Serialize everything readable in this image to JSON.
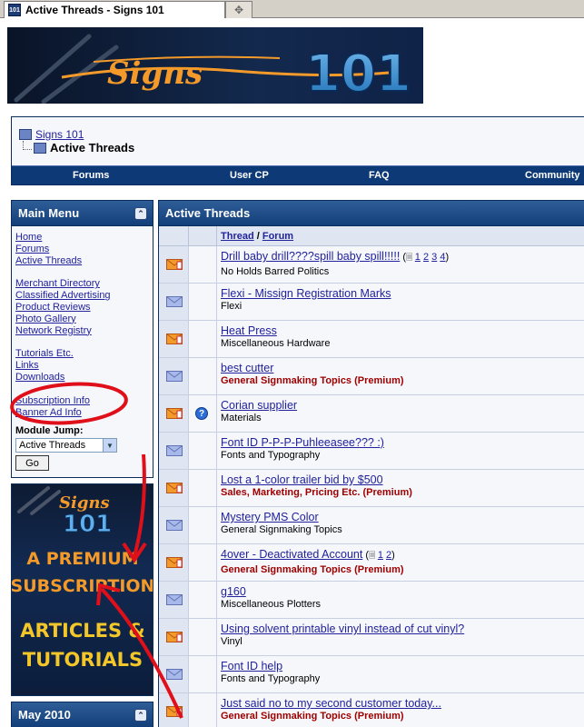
{
  "browser": {
    "tab_title": "Active Threads - Signs 101",
    "favicon": "101"
  },
  "banner": {
    "logo_script": "Signs",
    "logo_number": "101"
  },
  "breadcrumb": {
    "root": "Signs 101",
    "current": "Active Threads"
  },
  "navbar": [
    "Forums",
    "User CP",
    "FAQ",
    "Community"
  ],
  "main_menu": {
    "title": "Main Menu",
    "groups": [
      [
        "Home",
        "Forums",
        "Active Threads"
      ],
      [
        "Merchant Directory",
        "Classified Advertising",
        "Product Reviews",
        "Photo Gallery",
        "Network Registry"
      ],
      [
        "Tutorials Etc.",
        "Links",
        "Downloads"
      ],
      [
        "Subscription Info",
        "Banner Ad Info"
      ]
    ],
    "module_jump_label": "Module Jump:",
    "module_jump_value": "Active Threads",
    "go_label": "Go"
  },
  "ad": {
    "brand_script": "Signs",
    "brand_number": "101",
    "line1": "A PREMIUM",
    "line2": "SUBSCRIPTION",
    "line3": "ARTICLES &",
    "line4": "TUTORIALS"
  },
  "calendar": {
    "title": "May 2010"
  },
  "threads": {
    "title": "Active Threads",
    "col_thread": "Thread",
    "col_sep": " / ",
    "col_forum": "Forum",
    "rows": [
      {
        "title": "Drill baby drill????spill baby spill!!!!!",
        "forum": "No Holds Barred Politics",
        "premium": false,
        "hot": true,
        "pages": [
          "1",
          "2",
          "3",
          "4"
        ],
        "icon": ""
      },
      {
        "title": "Flexi - Missign Registration Marks",
        "forum": "Flexi",
        "premium": false,
        "hot": false,
        "pages": [],
        "icon": ""
      },
      {
        "title": "Heat Press",
        "forum": "Miscellaneous Hardware",
        "premium": false,
        "hot": true,
        "pages": [],
        "icon": ""
      },
      {
        "title": "best cutter",
        "forum": "General Signmaking Topics (Premium)",
        "premium": true,
        "hot": false,
        "pages": [],
        "icon": ""
      },
      {
        "title": "Corian supplier",
        "forum": "Materials",
        "premium": false,
        "hot": true,
        "pages": [],
        "icon": "question"
      },
      {
        "title": "Font ID P-P-P-Puhleeasee??? :)",
        "forum": "Fonts and Typography",
        "premium": false,
        "hot": false,
        "pages": [],
        "icon": ""
      },
      {
        "title": "Lost a 1-color trailer bid by $500",
        "forum": "Sales, Marketing, Pricing Etc. (Premium)",
        "premium": true,
        "hot": true,
        "pages": [],
        "icon": ""
      },
      {
        "title": "Mystery PMS Color",
        "forum": "General Signmaking Topics",
        "premium": false,
        "hot": false,
        "pages": [],
        "icon": ""
      },
      {
        "title": "4over - Deactivated Account",
        "forum": "General Signmaking Topics (Premium)",
        "premium": true,
        "hot": true,
        "pages": [
          "1",
          "2"
        ],
        "icon": ""
      },
      {
        "title": "g160",
        "forum": "Miscellaneous Plotters",
        "premium": false,
        "hot": false,
        "pages": [],
        "icon": ""
      },
      {
        "title": "Using solvent printable vinyl instead of cut vinyl?",
        "forum": "Vinyl",
        "premium": false,
        "hot": true,
        "pages": [],
        "icon": ""
      },
      {
        "title": "Font ID help",
        "forum": "Fonts and Typography",
        "premium": false,
        "hot": false,
        "pages": [],
        "icon": ""
      },
      {
        "title": "Just said no to my second customer today...",
        "forum": "General Signmaking Topics (Premium)",
        "premium": true,
        "hot": true,
        "pages": [],
        "icon": ""
      }
    ]
  },
  "colors": {
    "nav_blue": "#0d3a76",
    "link": "#22229c",
    "premium": "#a00000",
    "annotation_red": "#e0101a",
    "ad_orange": "#f39a2a"
  }
}
